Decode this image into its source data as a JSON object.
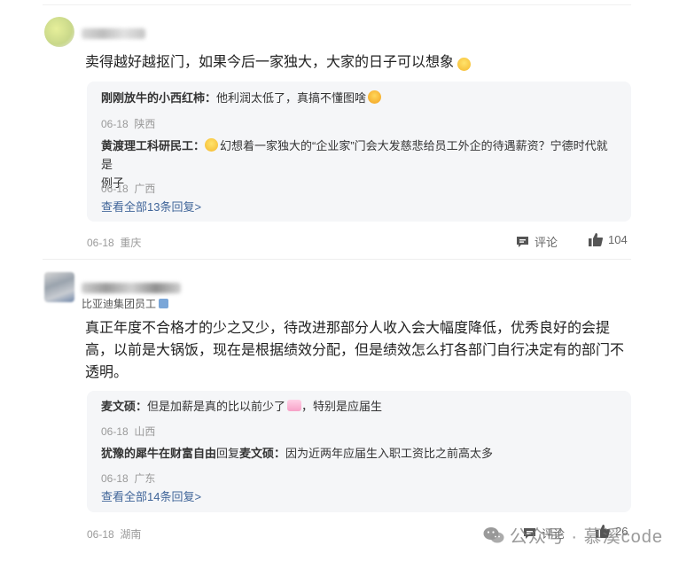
{
  "comments": [
    {
      "text": "卖得越好越抠门，如果今后一家独大，大家的日子可以想象",
      "replies": [
        {
          "author": "刚刚放牛的小西红柿：",
          "text": "他利润太低了，真搞不懂图啥",
          "date": "06-18",
          "region": "陕西"
        },
        {
          "author": "黄渡理工科研民工：",
          "text": "幻想着一家独大的“企业家”门会大发慈悲给员工外企的待遇薪资？宁德时代就是",
          "text2": "例子",
          "date": "06-18",
          "region": "广西"
        }
      ],
      "see_all": "查看全部13条回复>",
      "date": "06-18",
      "region": "重庆",
      "comment_label": "评论",
      "likes": "104"
    },
    {
      "user_subtitle": "比亚迪集团员工",
      "text_line1": "真正年度不合格才的少之又少，待改进那部分人收入会大幅度降低，优秀良好的会提",
      "text_line2": "高，以前是大锅饭，现在是根据绩效分配，但是绩效怎么打各部门自行决定有的部门不",
      "text_line3": "透明。",
      "replies": [
        {
          "author": "麦文硕：",
          "text": "但是加薪是真的比以前少了",
          "text_after": "，特别是应届生",
          "date": "06-18",
          "region": "山西"
        },
        {
          "author": "犹豫的犀牛在财富自由",
          "reply_word": "回复",
          "reply_to": "麦文硕：",
          "text": "因为近两年应届生入职工资比之前高太多",
          "date": "06-18",
          "region": "广东"
        }
      ],
      "see_all": "查看全部14条回复>",
      "date": "06-18",
      "region": "湖南",
      "comment_label": "评论",
      "likes": "26"
    }
  ],
  "watermark": "公众号 · 慕溪code",
  "icons": {
    "comment": "comment-icon",
    "like": "thumbs-up-icon",
    "badge": "verified-badge-icon",
    "wechat": "wechat-icon"
  },
  "colors": {
    "link": "#406599",
    "meta": "#9a9a9a",
    "reply_bg": "#f5f6f8"
  }
}
